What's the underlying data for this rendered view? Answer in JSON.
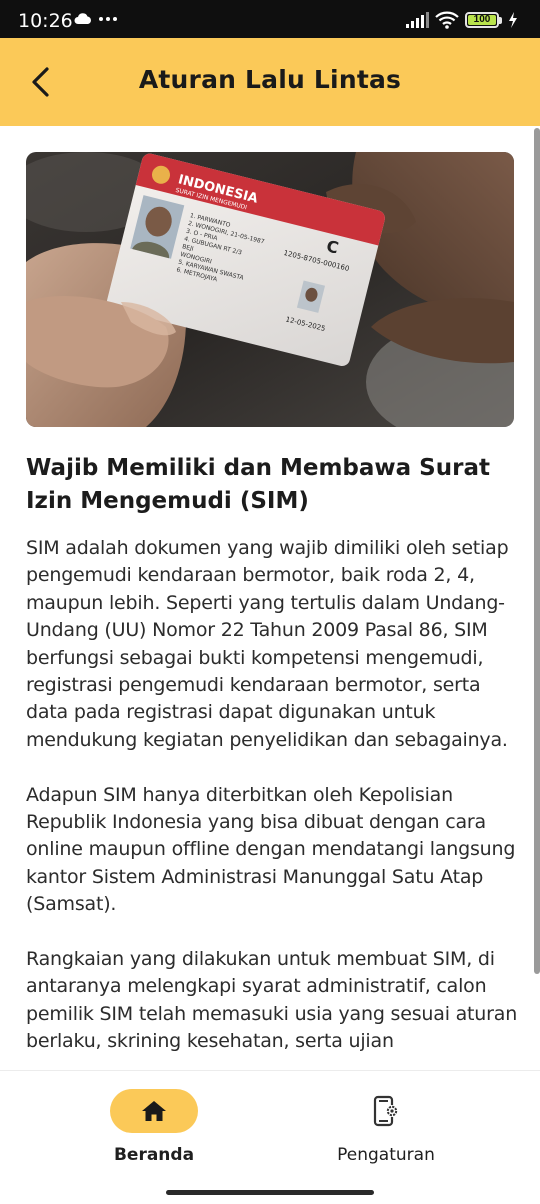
{
  "status_bar": {
    "time": "10:26",
    "battery": "100",
    "icons": [
      "cloud-icon",
      "more-dots-icon",
      "signal-icon",
      "wifi-icon",
      "battery-icon",
      "charging-icon"
    ]
  },
  "app_bar": {
    "title": "Aturan Lalu Lintas",
    "background": "#fbc958",
    "back_icon": "chevron-left-icon"
  },
  "article": {
    "image": {
      "card_header": "INDONESIA",
      "card_subheader": "SURAT IZIN MENGEMUDI",
      "card_class": "C",
      "card_number": "1205-8705-000160",
      "card_lines": [
        "1. PARWANTO",
        "2. WONOGIRI, 21-05-1987",
        "3. O - PRIA",
        "4. GUBUGAN RT 2/3",
        "BEJI",
        "WONOGIRI",
        "5. KARYAWAN SWASTA",
        "6. METROJAYA"
      ],
      "card_date": "12-05-2025"
    },
    "title": "Wajib Memiliki dan Membawa Surat Izin Mengemudi (SIM)",
    "paragraphs": [
      "SIM adalah dokumen yang wajib dimiliki oleh setiap pengemudi kendaraan bermotor, baik roda 2, 4, maupun lebih. Seperti yang tertulis dalam Undang-Undang (UU) Nomor 22 Tahun 2009 Pasal 86, SIM berfungsi sebagai bukti kompetensi mengemudi, registrasi pengemudi kendaraan bermotor, serta data pada registrasi dapat digunakan untuk mendukung kegiatan penyelidikan dan sebagainya.",
      "Adapun SIM hanya diterbitkan oleh Kepolisian Republik Indonesia yang bisa dibuat dengan cara online maupun offline dengan mendatangi langsung kantor Sistem Administrasi Manunggal Satu Atap (Samsat).",
      "Rangkaian yang dilakukan untuk membuat SIM, di antaranya melengkapi syarat administratif, calon pemilik SIM telah memasuki usia yang sesuai aturan berlaku, skrining kesehatan, serta ujian"
    ]
  },
  "bottom_nav": {
    "items": [
      {
        "label": "Beranda",
        "icon": "home-icon",
        "active": true
      },
      {
        "label": "Pengaturan",
        "icon": "phone-settings-icon",
        "active": false
      }
    ],
    "accent": "#fbc958"
  }
}
